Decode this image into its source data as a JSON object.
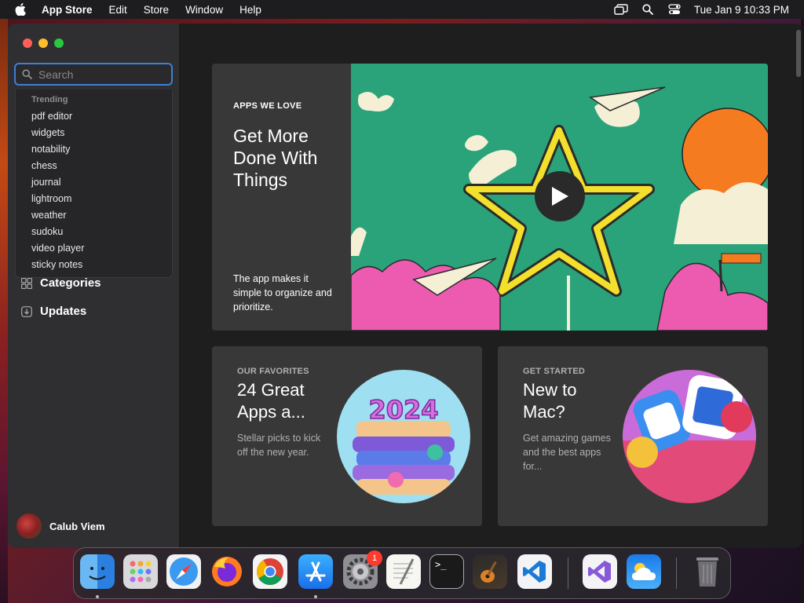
{
  "menubar": {
    "app_name": "App Store",
    "items": [
      "Edit",
      "Store",
      "Window",
      "Help"
    ],
    "clock": "Tue Jan 9  10:33 PM"
  },
  "sidebar": {
    "search_placeholder": "Search",
    "dropdown": {
      "title": "Trending",
      "items": [
        "pdf editor",
        "widgets",
        "notability",
        "chess",
        "journal",
        "lightroom",
        "weather",
        "sudoku",
        "video player",
        "sticky notes"
      ]
    },
    "nav": {
      "categories": "Categories",
      "updates": "Updates"
    },
    "user_name": "Calub Viem"
  },
  "hero": {
    "eyebrow": "APPS WE LOVE",
    "title": "Get More Done With Things",
    "description": "The app makes it simple to organize and prioritize."
  },
  "cards": [
    {
      "eyebrow": "OUR FAVORITES",
      "title": "24 Great Apps a...",
      "description": "Stellar picks to kick off the new year.",
      "image_text": "2024"
    },
    {
      "eyebrow": "GET STARTED",
      "title": "New to Mac?",
      "description": "Get amazing games and the best apps for..."
    }
  ],
  "dock": {
    "apps": [
      "finder-icon",
      "launchpad-icon",
      "safari-icon",
      "firefox-icon",
      "chrome-icon",
      "app-store-icon",
      "system-settings-icon",
      "textedit-icon",
      "terminal-icon",
      "garageband-icon",
      "vscode-icon",
      "visual-studio-icon",
      "weather-icon",
      "trash-icon"
    ],
    "settings_badge": "1",
    "terminal_prompt": ">_"
  },
  "colors": {
    "accent": "#3e7fd8",
    "sidebar_bg": "#2f2f31",
    "hero_green": "#2aa37a",
    "badge_red": "#ff3b30"
  }
}
